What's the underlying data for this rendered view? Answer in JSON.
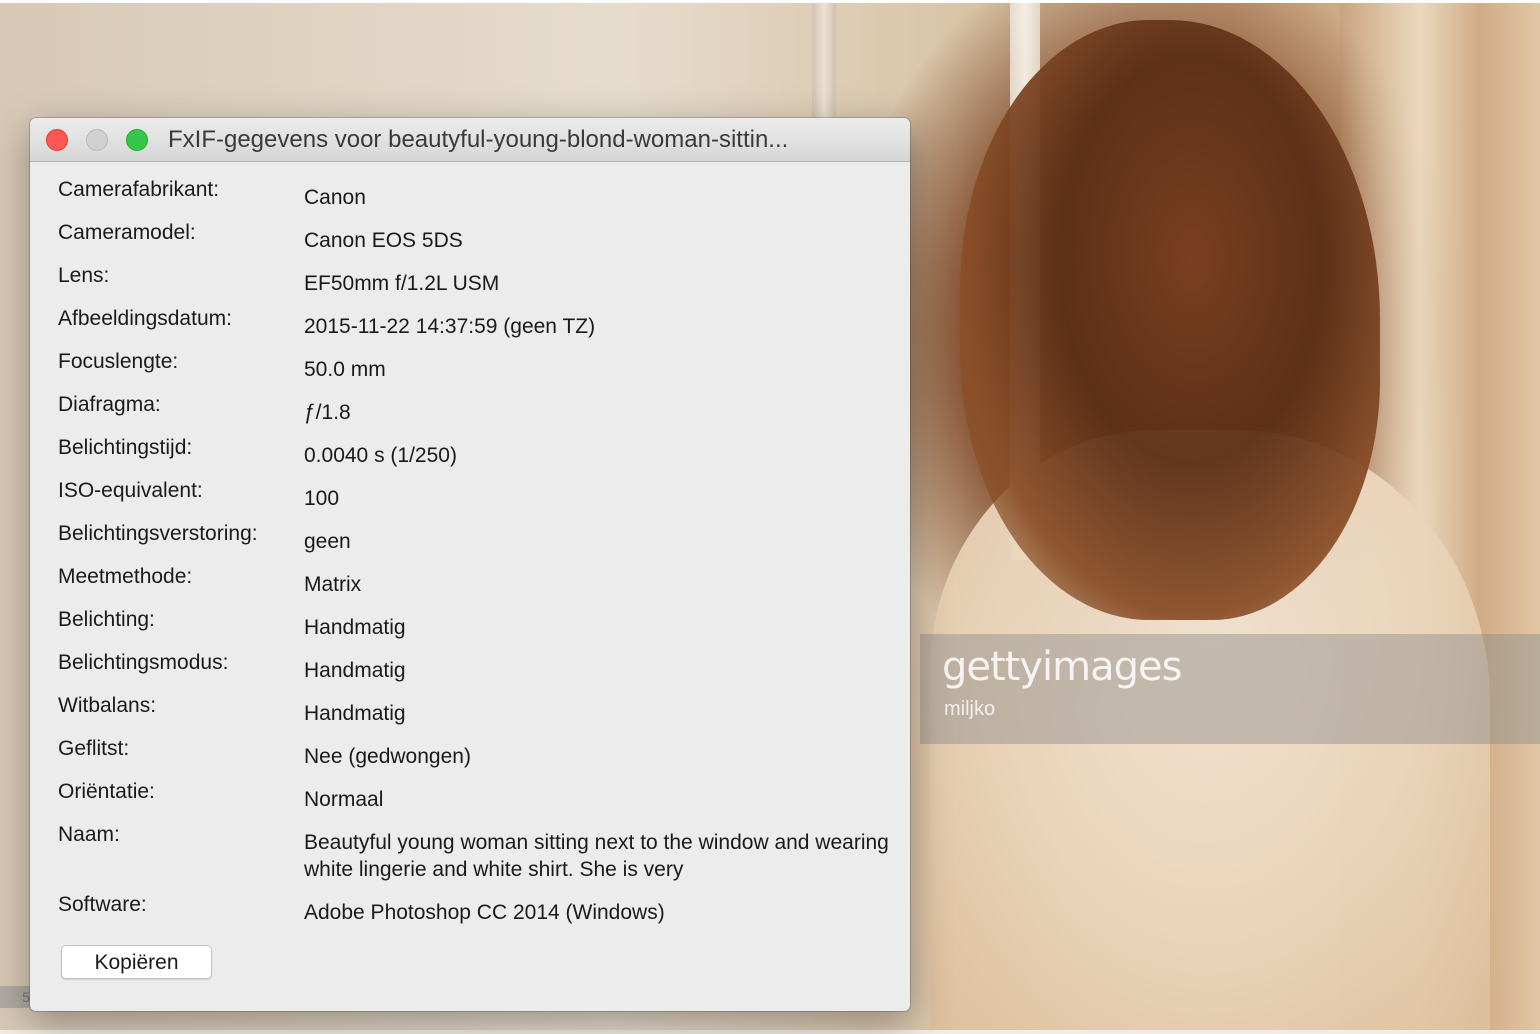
{
  "background": {
    "watermark_logo": "gettyimages",
    "watermark_credit": "miljko",
    "edge_tag": "5"
  },
  "dialog": {
    "title": "FxIF-gegevens voor beautyful-young-blond-woman-sittin...",
    "rows": [
      {
        "label": "Camerafabrikant:",
        "value": "Canon"
      },
      {
        "label": "Cameramodel:",
        "value": "Canon EOS 5DS"
      },
      {
        "label": "Lens:",
        "value": "EF50mm f/1.2L USM"
      },
      {
        "label": "Afbeeldingsdatum:",
        "value": "2015-11-22 14:37:59 (geen TZ)"
      },
      {
        "label": "Focuslengte:",
        "value": "50.0 mm"
      },
      {
        "label": "Diafragma:",
        "value": "ƒ/1.8"
      },
      {
        "label": "Belichtingstijd:",
        "value": "0.0040 s (1/250)"
      },
      {
        "label": "ISO-equivalent:",
        "value": "100"
      },
      {
        "label": "Belichtingsverstoring:",
        "value": "geen"
      },
      {
        "label": "Meetmethode:",
        "value": "Matrix"
      },
      {
        "label": "Belichting:",
        "value": "Handmatig"
      },
      {
        "label": "Belichtingsmodus:",
        "value": "Handmatig"
      },
      {
        "label": "Witbalans:",
        "value": "Handmatig"
      },
      {
        "label": "Geflitst:",
        "value": "Nee (gedwongen)"
      },
      {
        "label": "Oriëntatie:",
        "value": "Normaal"
      },
      {
        "label": "Naam:",
        "value": "Beautyful young woman sitting next to the window and wearing white lingerie and white shirt. She is very"
      },
      {
        "label": "Software:",
        "value": "Adobe Photoshop CC 2014 (Windows)"
      }
    ],
    "copy_button": "Kopiëren"
  }
}
